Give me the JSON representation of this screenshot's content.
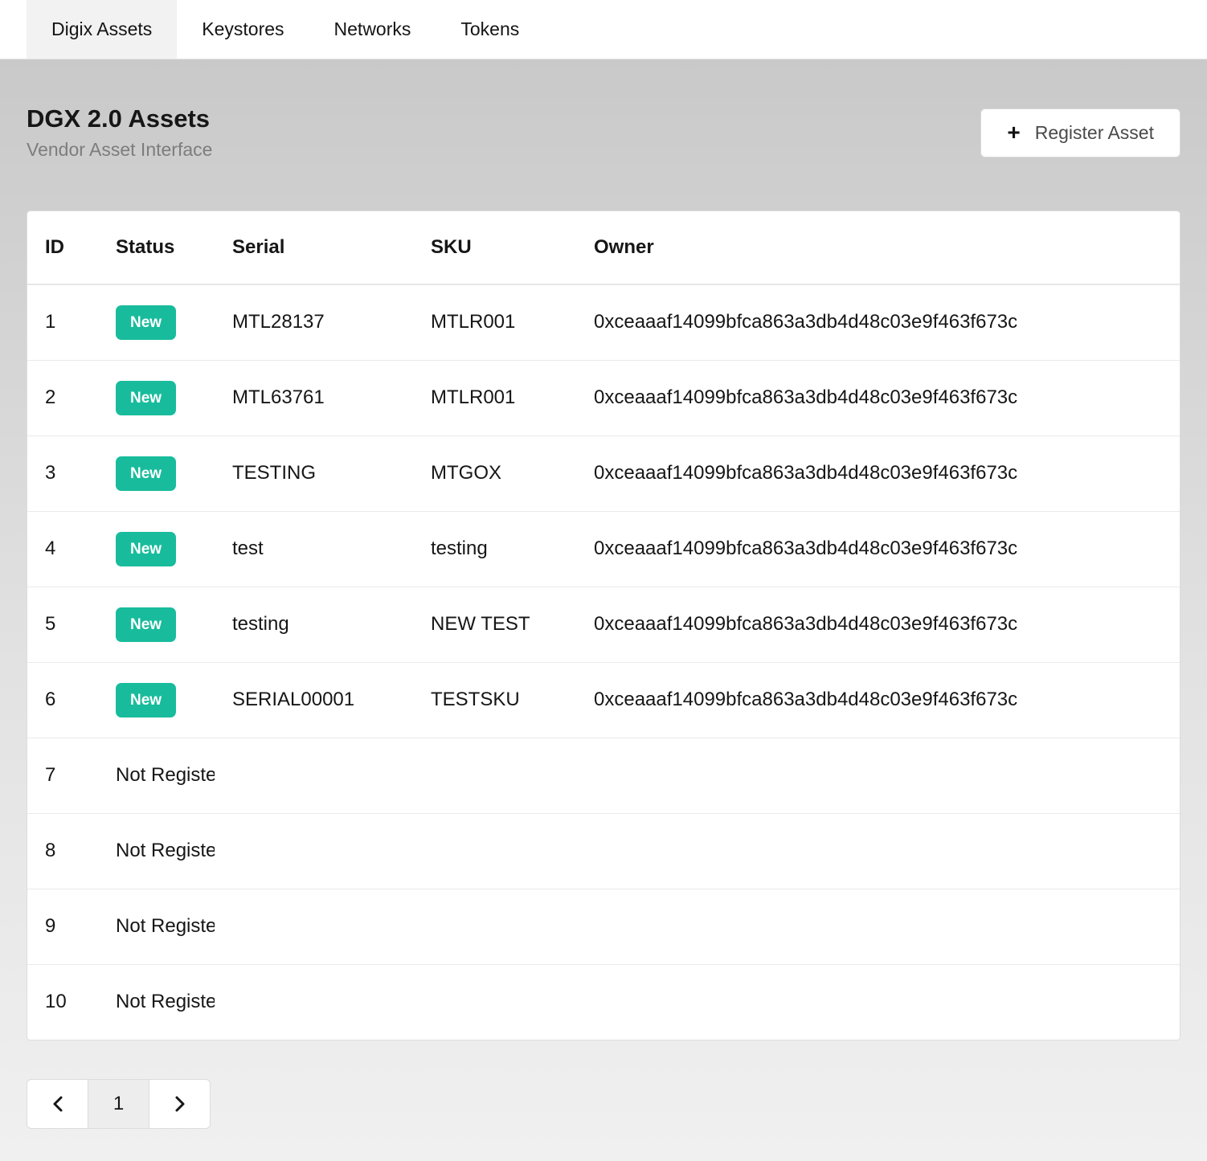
{
  "tabs": [
    {
      "label": "Digix Assets",
      "active": true
    },
    {
      "label": "Keystores",
      "active": false
    },
    {
      "label": "Networks",
      "active": false
    },
    {
      "label": "Tokens",
      "active": false
    }
  ],
  "header": {
    "title": "DGX 2.0 Assets",
    "subtitle": "Vendor Asset Interface",
    "register_button_label": "Register Asset",
    "plus_icon": "+"
  },
  "table": {
    "columns": [
      "ID",
      "Status",
      "Serial",
      "SKU",
      "Owner"
    ],
    "rows": [
      {
        "id": "1",
        "status": "New",
        "serial": "MTL28137",
        "sku": "MTLR001",
        "owner": "0xceaaaf14099bfca863a3db4d48c03e9f463f673c"
      },
      {
        "id": "2",
        "status": "New",
        "serial": "MTL63761",
        "sku": "MTLR001",
        "owner": "0xceaaaf14099bfca863a3db4d48c03e9f463f673c"
      },
      {
        "id": "3",
        "status": "New",
        "serial": "TESTING",
        "sku": "MTGOX",
        "owner": "0xceaaaf14099bfca863a3db4d48c03e9f463f673c"
      },
      {
        "id": "4",
        "status": "New",
        "serial": "test",
        "sku": "testing",
        "owner": "0xceaaaf14099bfca863a3db4d48c03e9f463f673c"
      },
      {
        "id": "5",
        "status": "New",
        "serial": "testing",
        "sku": "NEW TEST",
        "owner": "0xceaaaf14099bfca863a3db4d48c03e9f463f673c"
      },
      {
        "id": "6",
        "status": "New",
        "serial": "SERIAL00001",
        "sku": "TESTSKU",
        "owner": "0xceaaaf14099bfca863a3db4d48c03e9f463f673c"
      },
      {
        "id": "7",
        "status": "Not Registered",
        "serial": "",
        "sku": "",
        "owner": ""
      },
      {
        "id": "8",
        "status": "Not Registered",
        "serial": "",
        "sku": "",
        "owner": ""
      },
      {
        "id": "9",
        "status": "Not Registered",
        "serial": "",
        "sku": "",
        "owner": ""
      },
      {
        "id": "10",
        "status": "Not Registered",
        "serial": "",
        "sku": "",
        "owner": ""
      }
    ]
  },
  "pagination": {
    "current_page": "1"
  },
  "colors": {
    "badge": "#18bc9c",
    "tab_active_bg": "#f2f2f2"
  }
}
